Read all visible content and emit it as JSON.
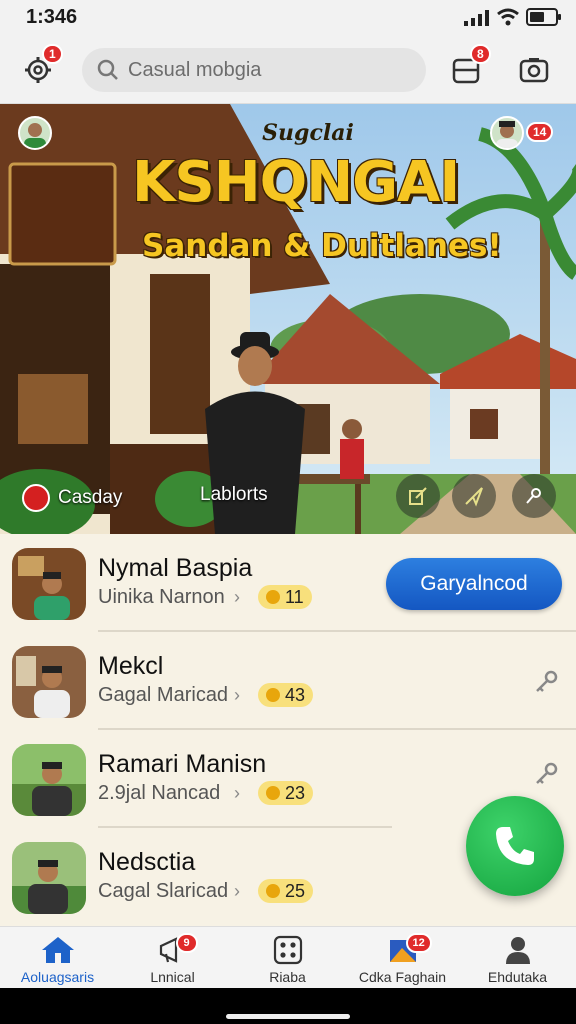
{
  "status_bar": {
    "time": "1:346",
    "battery_level": 0.6
  },
  "toolbar": {
    "settings_badge": "1",
    "search_placeholder": "Casual mobgia",
    "wallet_badge": "8"
  },
  "hero": {
    "title_small": "Sugclai",
    "title_large": "KSHQNGAI",
    "title_sub": "Sandan & Duitlanes!",
    "avatar_badge": "14",
    "chip_left": "Casday",
    "chip_right": "Lablorts"
  },
  "list": [
    {
      "name": "Nymal Baspia",
      "sub": "Uinika Narnon",
      "coins": "11",
      "action": "Garyalncod"
    },
    {
      "name": "Mekcl",
      "sub": "Gagal Maricad",
      "coins": "43"
    },
    {
      "name": "Ramari Manisn",
      "sub": "2.9jal Nancad",
      "coins": "23"
    },
    {
      "name": "Nedsctia",
      "sub": "Cagal Slaricad",
      "coins": "25"
    }
  ],
  "nav": [
    {
      "label": "Aoluagsaris",
      "icon": "home-icon",
      "active": true
    },
    {
      "label": "Lnnical",
      "icon": "megaphone-icon",
      "badge": "9"
    },
    {
      "label": "Riaba",
      "icon": "dice-icon"
    },
    {
      "label": "Cdka Faghain",
      "icon": "map-icon",
      "badge": "12"
    },
    {
      "label": "Ehdutaka",
      "icon": "person-icon"
    }
  ],
  "colors": {
    "accent_blue": "#1d62c9",
    "call_green": "#1fb34a",
    "badge_red": "#e02b2b",
    "title_yellow": "#f6c622"
  }
}
